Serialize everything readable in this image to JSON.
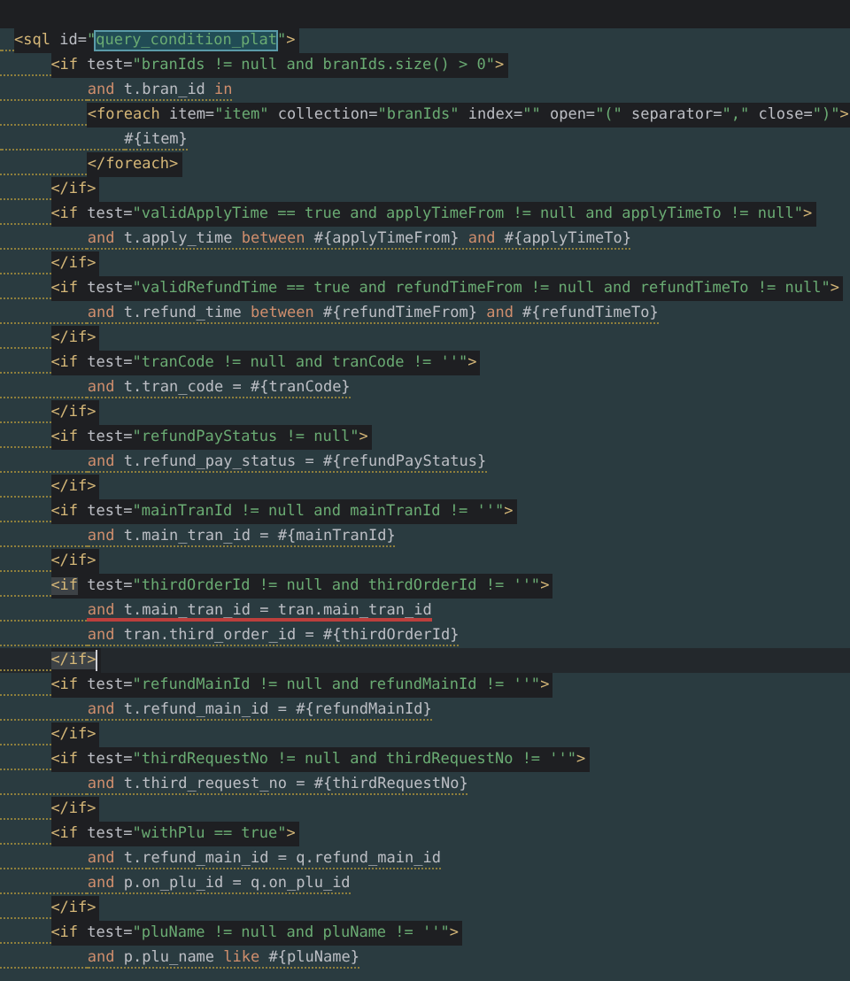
{
  "editor": {
    "blocks": [
      {
        "kind": "tag",
        "matched": false,
        "current": false,
        "open": [
          {
            "kind": "tag",
            "s": "<sql"
          },
          {
            "kind": "attr",
            "s": " id="
          },
          {
            "kind": "str",
            "s": "\""
          },
          {
            "kind": "sel",
            "s": "query_condition_plat"
          },
          {
            "kind": "str",
            "s": "\""
          },
          {
            "kind": "tag",
            "s": ">"
          }
        ],
        "children": [
          {
            "kind": "tag",
            "matched": false,
            "current": false,
            "open": [
              {
                "kind": "tag",
                "s": "<if"
              },
              {
                "kind": "attr",
                "s": " test="
              },
              {
                "kind": "str",
                "s": "\"branIds != null and branIds.size() > 0\""
              },
              {
                "kind": "tag",
                "s": ">"
              }
            ],
            "children": [
              {
                "kind": "sql",
                "error": false,
                "tokens": [
                  {
                    "kind": "kw",
                    "s": "and"
                  },
                  {
                    "kind": "txt",
                    "s": " t.bran_id "
                  },
                  {
                    "kind": "kw",
                    "s": "in"
                  }
                ]
              },
              {
                "kind": "tag",
                "matched": false,
                "current": false,
                "open": [
                  {
                    "kind": "tag",
                    "s": "<foreach"
                  },
                  {
                    "kind": "attr",
                    "s": " item="
                  },
                  {
                    "kind": "str",
                    "s": "\"item\""
                  },
                  {
                    "kind": "attr",
                    "s": " collection="
                  },
                  {
                    "kind": "str",
                    "s": "\"branIds\""
                  },
                  {
                    "kind": "attr",
                    "s": " index="
                  },
                  {
                    "kind": "str",
                    "s": "\"\""
                  },
                  {
                    "kind": "attr",
                    "s": " open="
                  },
                  {
                    "kind": "str",
                    "s": "\"(\""
                  },
                  {
                    "kind": "attr",
                    "s": " separator="
                  },
                  {
                    "kind": "str",
                    "s": "\",\""
                  },
                  {
                    "kind": "attr",
                    "s": " close="
                  },
                  {
                    "kind": "str",
                    "s": "\")\""
                  },
                  {
                    "kind": "tag",
                    "s": ">"
                  }
                ],
                "children": [
                  {
                    "kind": "sql",
                    "error": false,
                    "tokens": [
                      {
                        "kind": "txt",
                        "s": "#{item}"
                      }
                    ]
                  }
                ],
                "close": [
                  {
                    "kind": "tag",
                    "s": "</foreach>"
                  }
                ]
              }
            ],
            "close": [
              {
                "kind": "tag",
                "s": "</if>"
              }
            ]
          },
          {
            "kind": "tag",
            "matched": false,
            "current": false,
            "open": [
              {
                "kind": "tag",
                "s": "<if"
              },
              {
                "kind": "attr",
                "s": " test="
              },
              {
                "kind": "str",
                "s": "\"validApplyTime == true and applyTimeFrom != null and applyTimeTo != null\""
              },
              {
                "kind": "tag",
                "s": ">"
              }
            ],
            "children": [
              {
                "kind": "sql",
                "error": false,
                "tokens": [
                  {
                    "kind": "kw",
                    "s": "and"
                  },
                  {
                    "kind": "txt",
                    "s": " t.apply_time "
                  },
                  {
                    "kind": "kw",
                    "s": "between"
                  },
                  {
                    "kind": "txt",
                    "s": " #{applyTimeFrom} "
                  },
                  {
                    "kind": "kw",
                    "s": "and"
                  },
                  {
                    "kind": "txt",
                    "s": " #{applyTimeTo}"
                  }
                ]
              }
            ],
            "close": [
              {
                "kind": "tag",
                "s": "</if>"
              }
            ]
          },
          {
            "kind": "tag",
            "matched": false,
            "current": false,
            "open": [
              {
                "kind": "tag",
                "s": "<if"
              },
              {
                "kind": "attr",
                "s": " test="
              },
              {
                "kind": "str",
                "s": "\"validRefundTime == true and refundTimeFrom != null and refundTimeTo != null\""
              },
              {
                "kind": "tag",
                "s": ">"
              }
            ],
            "children": [
              {
                "kind": "sql",
                "error": false,
                "tokens": [
                  {
                    "kind": "kw",
                    "s": "and"
                  },
                  {
                    "kind": "txt",
                    "s": " t.refund_time "
                  },
                  {
                    "kind": "kw",
                    "s": "between"
                  },
                  {
                    "kind": "txt",
                    "s": " #{refundTimeFrom} "
                  },
                  {
                    "kind": "kw",
                    "s": "and"
                  },
                  {
                    "kind": "txt",
                    "s": " #{refundTimeTo}"
                  }
                ]
              }
            ],
            "close": [
              {
                "kind": "tag",
                "s": "</if>"
              }
            ]
          },
          {
            "kind": "tag",
            "matched": false,
            "current": false,
            "open": [
              {
                "kind": "tag",
                "s": "<if"
              },
              {
                "kind": "attr",
                "s": " test="
              },
              {
                "kind": "str",
                "s": "\"tranCode != null and tranCode != ''\""
              },
              {
                "kind": "tag",
                "s": ">"
              }
            ],
            "children": [
              {
                "kind": "sql",
                "error": false,
                "tokens": [
                  {
                    "kind": "kw",
                    "s": "and"
                  },
                  {
                    "kind": "txt",
                    "s": " t.tran_code = #{tranCode}"
                  }
                ]
              }
            ],
            "close": [
              {
                "kind": "tag",
                "s": "</if>"
              }
            ]
          },
          {
            "kind": "tag",
            "matched": false,
            "current": false,
            "open": [
              {
                "kind": "tag",
                "s": "<if"
              },
              {
                "kind": "attr",
                "s": " test="
              },
              {
                "kind": "str",
                "s": "\"refundPayStatus != null\""
              },
              {
                "kind": "tag",
                "s": ">"
              }
            ],
            "children": [
              {
                "kind": "sql",
                "error": false,
                "tokens": [
                  {
                    "kind": "kw",
                    "s": "and"
                  },
                  {
                    "kind": "txt",
                    "s": " t.refund_pay_status = #{refundPayStatus}"
                  }
                ]
              }
            ],
            "close": [
              {
                "kind": "tag",
                "s": "</if>"
              }
            ]
          },
          {
            "kind": "tag",
            "matched": false,
            "current": false,
            "open": [
              {
                "kind": "tag",
                "s": "<if"
              },
              {
                "kind": "attr",
                "s": " test="
              },
              {
                "kind": "str",
                "s": "\"mainTranId != null and mainTranId != ''\""
              },
              {
                "kind": "tag",
                "s": ">"
              }
            ],
            "children": [
              {
                "kind": "sql",
                "error": false,
                "tokens": [
                  {
                    "kind": "kw",
                    "s": "and"
                  },
                  {
                    "kind": "txt",
                    "s": " t.main_tran_id = #{mainTranId}"
                  }
                ]
              }
            ],
            "close": [
              {
                "kind": "tag",
                "s": "</if>"
              }
            ]
          },
          {
            "kind": "tag",
            "matched": true,
            "current": true,
            "open": [
              {
                "kind": "tag",
                "s": "<if"
              },
              {
                "kind": "attr",
                "s": " test="
              },
              {
                "kind": "str",
                "s": "\"thirdOrderId != null and thirdOrderId != ''\""
              },
              {
                "kind": "tag",
                "s": ">"
              }
            ],
            "children": [
              {
                "kind": "sql",
                "error": true,
                "tokens": [
                  {
                    "kind": "kw",
                    "s": "and"
                  },
                  {
                    "kind": "txt",
                    "s": " t.main_tran_id = tran.main_tran_id"
                  }
                ]
              },
              {
                "kind": "sql",
                "error": false,
                "tokens": [
                  {
                    "kind": "kw",
                    "s": "and"
                  },
                  {
                    "kind": "txt",
                    "s": " tran.third_order_id = #{thirdOrderId}"
                  }
                ]
              }
            ],
            "close": [
              {
                "kind": "tag",
                "s": "</if>"
              }
            ]
          },
          {
            "kind": "tag",
            "matched": false,
            "current": false,
            "open": [
              {
                "kind": "tag",
                "s": "<if"
              },
              {
                "kind": "attr",
                "s": " test="
              },
              {
                "kind": "str",
                "s": "\"refundMainId != null and refundMainId != ''\""
              },
              {
                "kind": "tag",
                "s": ">"
              }
            ],
            "children": [
              {
                "kind": "sql",
                "error": false,
                "tokens": [
                  {
                    "kind": "kw",
                    "s": "and"
                  },
                  {
                    "kind": "txt",
                    "s": " t.refund_main_id = #{refundMainId}"
                  }
                ]
              }
            ],
            "close": [
              {
                "kind": "tag",
                "s": "</if>"
              }
            ]
          },
          {
            "kind": "tag",
            "matched": false,
            "current": false,
            "open": [
              {
                "kind": "tag",
                "s": "<if"
              },
              {
                "kind": "attr",
                "s": " test="
              },
              {
                "kind": "str",
                "s": "\"thirdRequestNo != null and thirdRequestNo != ''\""
              },
              {
                "kind": "tag",
                "s": ">"
              }
            ],
            "children": [
              {
                "kind": "sql",
                "error": false,
                "tokens": [
                  {
                    "kind": "kw",
                    "s": "and"
                  },
                  {
                    "kind": "txt",
                    "s": " t.third_request_no = #{thirdRequestNo}"
                  }
                ]
              }
            ],
            "close": [
              {
                "kind": "tag",
                "s": "</if>"
              }
            ]
          },
          {
            "kind": "tag",
            "matched": false,
            "current": false,
            "open": [
              {
                "kind": "tag",
                "s": "<if"
              },
              {
                "kind": "attr",
                "s": " test="
              },
              {
                "kind": "str",
                "s": "\"withPlu == true\""
              },
              {
                "kind": "tag",
                "s": ">"
              }
            ],
            "children": [
              {
                "kind": "sql",
                "error": false,
                "tokens": [
                  {
                    "kind": "kw",
                    "s": "and"
                  },
                  {
                    "kind": "txt",
                    "s": " t.refund_main_id = q.refund_main_id"
                  }
                ]
              },
              {
                "kind": "sql",
                "error": false,
                "tokens": [
                  {
                    "kind": "kw",
                    "s": "and"
                  },
                  {
                    "kind": "txt",
                    "s": " p.on_plu_id = q.on_plu_id"
                  }
                ]
              }
            ],
            "close": [
              {
                "kind": "tag",
                "s": "</if>"
              }
            ]
          },
          {
            "kind": "tag",
            "matched": false,
            "current": false,
            "open": [
              {
                "kind": "tag",
                "s": "<if"
              },
              {
                "kind": "attr",
                "s": " test="
              },
              {
                "kind": "str",
                "s": "\"pluName != null and pluName != ''\""
              },
              {
                "kind": "tag",
                "s": ">"
              }
            ],
            "children": [
              {
                "kind": "sql",
                "error": false,
                "tokens": [
                  {
                    "kind": "kw",
                    "s": "and"
                  },
                  {
                    "kind": "txt",
                    "s": " p.plu_name "
                  },
                  {
                    "kind": "kw",
                    "s": "like"
                  },
                  {
                    "kind": "txt",
                    "s": " #{pluName}"
                  }
                ]
              }
            ]
          }
        ]
      }
    ]
  }
}
